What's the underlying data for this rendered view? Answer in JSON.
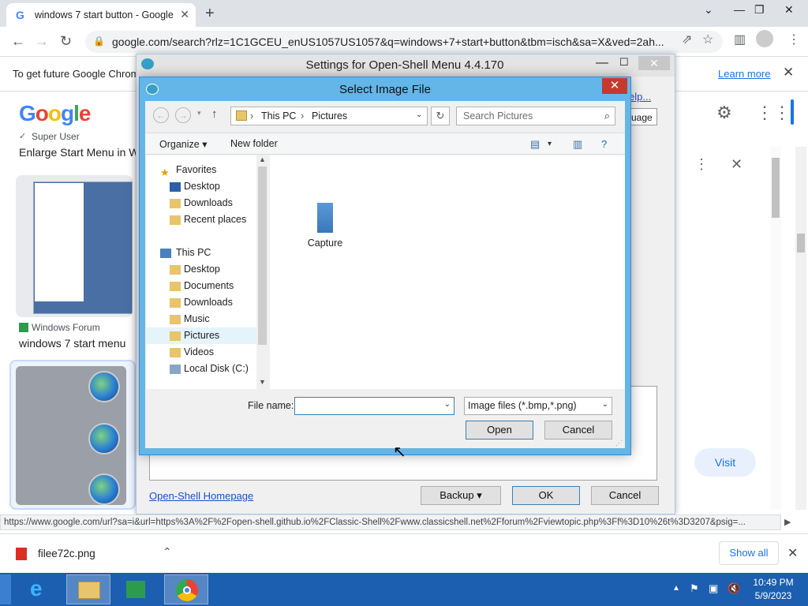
{
  "browser": {
    "tab_title": "windows 7 start button - Google",
    "url": "google.com/search?rlz=1C1GCEU_enUS1057US1057&q=windows+7+start+button&tbm=isch&sa=X&ved=2ah...",
    "infobar_text": "To get future Google Chrome",
    "infobar_learn_more": "Learn more"
  },
  "google": {
    "logo": "Google",
    "result1_source": "Super User",
    "result1_title": "Enlarge Start Menu in W",
    "result2_source": "Windows Forum",
    "result2_title": "windows 7 start menu",
    "visit_label": "Visit",
    "status_url": "https://www.google.com/url?sa=i&url=https%3A%2F%2Fopen-shell.github.io%2FClassic-Shell%2Fwww.classicshell.net%2Fforum%2Fviewtopic.php%3Ff%3D10%26t%3D3207&psig=..."
  },
  "downloads": {
    "filename": "filee72c.png",
    "show_all": "Show all"
  },
  "settings": {
    "title": "Settings for Open-Shell Menu 4.4.170",
    "help_link": "elp...",
    "tab_fragment": "uage",
    "homepage_link": "Open-Shell Homepage",
    "backup": "Backup",
    "ok": "OK",
    "cancel": "Cancel"
  },
  "dialog": {
    "title": "Select Image File",
    "crumbs": [
      "This PC",
      "Pictures"
    ],
    "search_placeholder": "Search Pictures",
    "organize": "Organize",
    "new_folder": "New folder",
    "nav": {
      "favorites": "Favorites",
      "fav_items": [
        "Desktop",
        "Downloads",
        "Recent places"
      ],
      "this_pc": "This PC",
      "pc_items": [
        "Desktop",
        "Documents",
        "Downloads",
        "Music",
        "Pictures",
        "Videos",
        "Local Disk (C:)"
      ]
    },
    "file": "Capture",
    "file_name_label": "File name:",
    "file_name_value": "",
    "file_type": "Image files (*.bmp,*.png)",
    "open": "Open",
    "cancel": "Cancel"
  },
  "taskbar": {
    "time": "10:49 PM",
    "date": "5/9/2023"
  }
}
